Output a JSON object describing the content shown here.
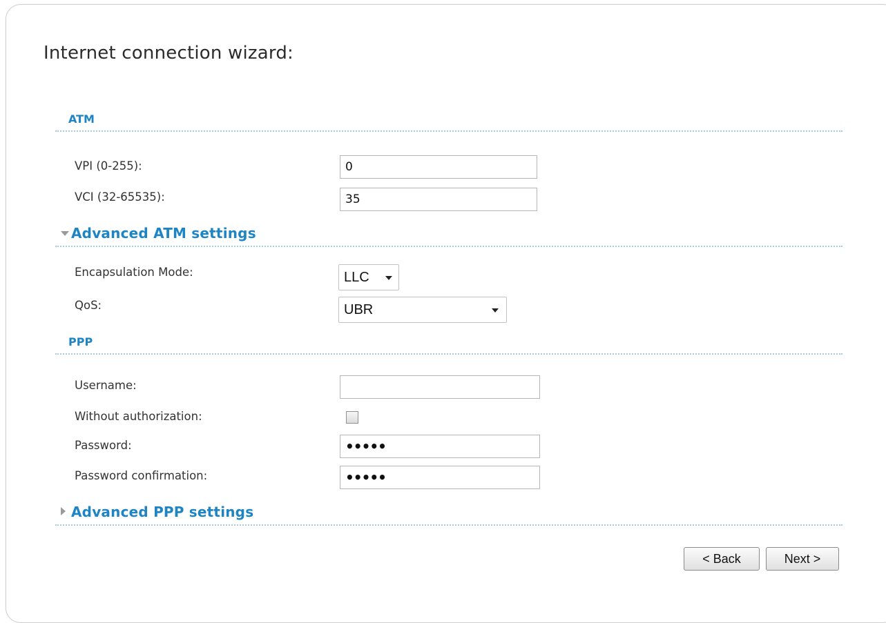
{
  "page": {
    "title": "Internet connection wizard:"
  },
  "atm": {
    "header": "ATM",
    "vpi_label": "VPI (0-255):",
    "vpi_value": "0",
    "vci_label": "VCI (32-65535):",
    "vci_value": "35"
  },
  "advanced_atm": {
    "header": "Advanced ATM settings",
    "expanded": true,
    "encapsulation_label": "Encapsulation Mode:",
    "encapsulation_value": "LLC",
    "qos_label": "QoS:",
    "qos_value": "UBR"
  },
  "ppp": {
    "header": "PPP",
    "username_label": "Username:",
    "username_value": "",
    "without_auth_label": "Without authorization:",
    "without_auth_checked": false,
    "password_label": "Password:",
    "password_value": "•••••",
    "password_confirm_label": "Password confirmation:",
    "password_confirm_value": "•••••"
  },
  "advanced_ppp": {
    "header": "Advanced PPP settings",
    "expanded": false
  },
  "buttons": {
    "back": "< Back",
    "next": "Next >"
  },
  "colors": {
    "section_header": "#1e84c4",
    "divider": "#a8c8de",
    "label_text": "#333333"
  },
  "icons": {
    "expanded": "triangle-down-icon",
    "collapsed": "triangle-right-icon",
    "dropdown": "caret-down-icon"
  }
}
